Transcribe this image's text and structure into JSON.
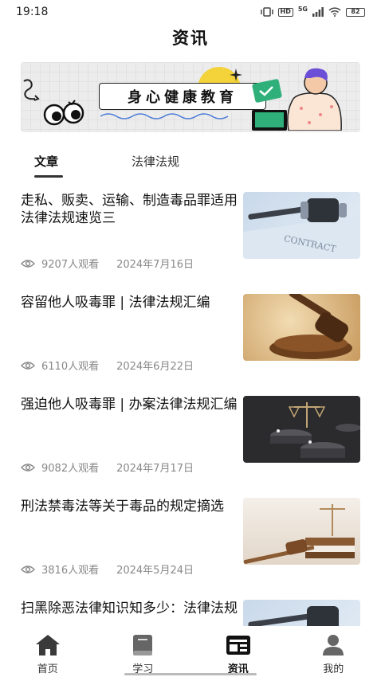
{
  "status_bar": {
    "time": "19:18",
    "net": "5G",
    "hd": "HD",
    "battery": "82"
  },
  "header": {
    "title": "资讯"
  },
  "banner": {
    "text": "身心健康教育"
  },
  "tabs": [
    {
      "label": "文章",
      "active": true
    },
    {
      "label": "法律法规",
      "active": false
    }
  ],
  "articles": [
    {
      "title": "走私、贩卖、运输、制造毒品罪适用法律法规速览三",
      "views": "9207人观看",
      "date": "2024年7月16日",
      "thumb_text": "CONTRACT"
    },
    {
      "title": "容留他人吸毒罪 | 法律法规汇编",
      "views": "6110人观看",
      "date": "2024年6月22日"
    },
    {
      "title": "强迫他人吸毒罪 | 办案法律法规汇编",
      "views": "9082人观看",
      "date": "2024年7月17日"
    },
    {
      "title": "刑法禁毒法等关于毒品的规定摘选",
      "views": "3816人观看",
      "date": "2024年5月24日"
    },
    {
      "title": "扫黑除恶法律知识知多少：法律法规",
      "views": "",
      "date": ""
    }
  ],
  "tabbar": [
    {
      "label": "首页",
      "icon": "home-icon"
    },
    {
      "label": "学习",
      "icon": "book-icon"
    },
    {
      "label": "资讯",
      "icon": "news-icon"
    },
    {
      "label": "我的",
      "icon": "profile-icon"
    }
  ],
  "colors": {
    "accent": "#333333",
    "meta": "#888888",
    "banner_bg": "#ececec"
  }
}
